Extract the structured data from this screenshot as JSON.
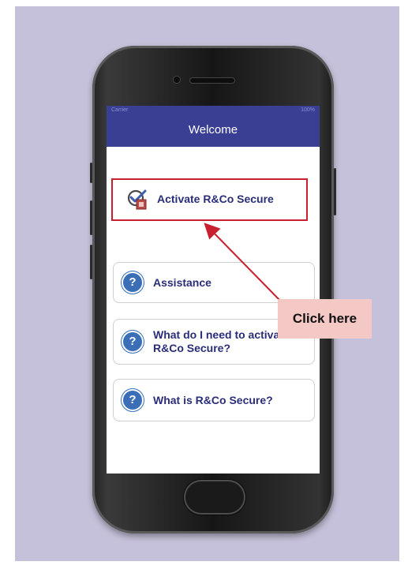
{
  "status_bar": {
    "left": "Carrier",
    "right": "100%"
  },
  "nav": {
    "title": "Welcome"
  },
  "menu": [
    {
      "label": "Activate R&Co Secure",
      "icon": "activate-check-icon"
    },
    {
      "label": "Assistance",
      "icon": "help-question-icon"
    },
    {
      "label": "What do I need to activate R&Co Secure?",
      "icon": "help-question-icon"
    },
    {
      "label": "What is R&Co Secure?",
      "icon": "help-question-icon"
    }
  ],
  "annotation": {
    "callout_text": "Click here",
    "highlight_color": "#c8202f",
    "callout_color": "#f4c8c5"
  },
  "question_mark": "?",
  "colors": {
    "background": "#c6c1da",
    "navbar": "#3a3f93",
    "button_text": "#2a2d78",
    "help_icon": "#3a6fb8"
  }
}
